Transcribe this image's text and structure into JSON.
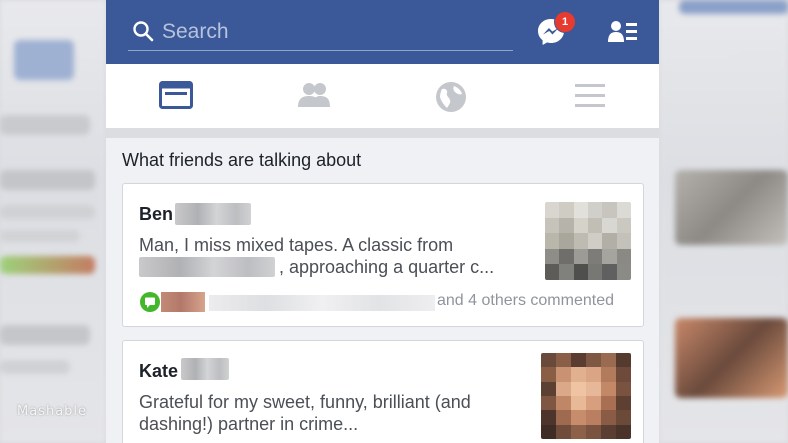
{
  "search": {
    "placeholder": "Search"
  },
  "header": {
    "messages_badge": "1"
  },
  "tabs": [
    {
      "icon": "news-feed-icon",
      "active": true
    },
    {
      "icon": "friends-icon",
      "active": false
    },
    {
      "icon": "globe-icon",
      "active": false
    },
    {
      "icon": "menu-icon",
      "active": false
    }
  ],
  "section": {
    "title": "What friends are talking about"
  },
  "posts": [
    {
      "author": "Ben",
      "text_line1": "Man, I miss mixed tapes. A classic from",
      "text_line2": ", approaching a quarter c...",
      "comments_text": "and 4 others commented"
    },
    {
      "author": "Kate",
      "text_line1": "Grateful for my sweet, funny, brilliant (and",
      "text_line2": "dashing!) partner in crime..."
    }
  ],
  "watermark": "Mashable",
  "colors": {
    "brand_blue": "#3b5998",
    "badge_red": "#e63b2e",
    "comment_green": "#42b72a"
  }
}
